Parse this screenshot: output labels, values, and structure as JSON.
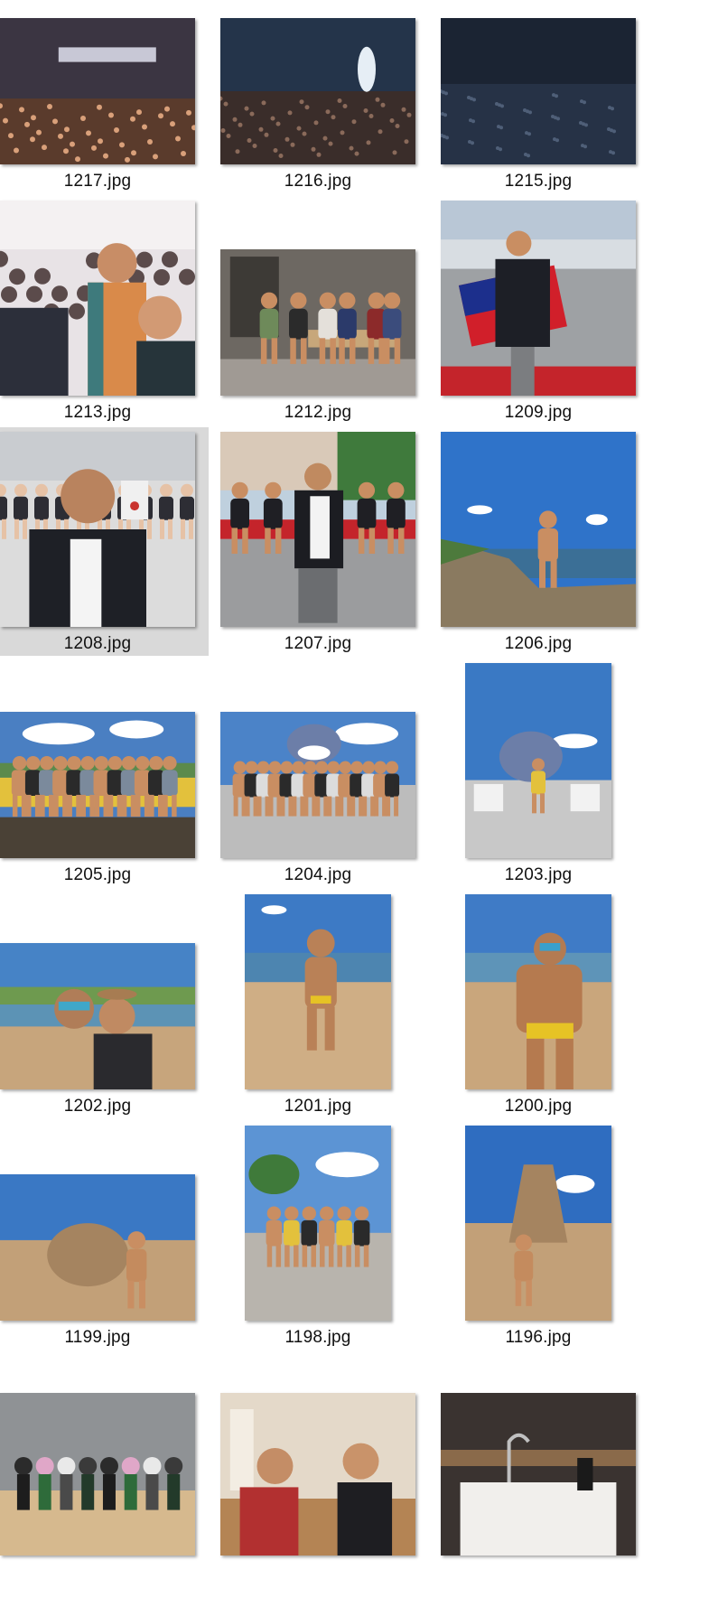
{
  "files": [
    {
      "name": "1217.jpg",
      "scene": "concert-crowd",
      "orientation": "landscape"
    },
    {
      "name": "1216.jpg",
      "scene": "concert-stage",
      "orientation": "landscape"
    },
    {
      "name": "1215.jpg",
      "scene": "concert-dark",
      "orientation": "landscape"
    },
    {
      "name": "1213.jpg",
      "scene": "stadium-selfie",
      "orientation": "square"
    },
    {
      "name": "1212.jpg",
      "scene": "indoor-group",
      "orientation": "landscape"
    },
    {
      "name": "1209.jpg",
      "scene": "flag-plaza",
      "orientation": "square"
    },
    {
      "name": "1208.jpg",
      "scene": "event-selfie",
      "orientation": "square",
      "selected": true
    },
    {
      "name": "1207.jpg",
      "scene": "street-portrait",
      "orientation": "square"
    },
    {
      "name": "1206.jpg",
      "scene": "coast-rocks",
      "orientation": "square"
    },
    {
      "name": "1205.jpg",
      "scene": "deck-group",
      "orientation": "landscape"
    },
    {
      "name": "1204.jpg",
      "scene": "stitch-group",
      "orientation": "landscape"
    },
    {
      "name": "1203.jpg",
      "scene": "stitch-solo",
      "orientation": "portrait"
    },
    {
      "name": "1202.jpg",
      "scene": "beach-selfie",
      "orientation": "landscape"
    },
    {
      "name": "1201.jpg",
      "scene": "beach-standing",
      "orientation": "portrait"
    },
    {
      "name": "1200.jpg",
      "scene": "beach-closeup",
      "orientation": "portrait"
    },
    {
      "name": "1199.jpg",
      "scene": "sand-sculpture-wide",
      "orientation": "landscape"
    },
    {
      "name": "1198.jpg",
      "scene": "walk-group",
      "orientation": "portrait"
    },
    {
      "name": "1196.jpg",
      "scene": "sand-sculpture-tall",
      "orientation": "portrait"
    },
    {
      "name": "",
      "scene": "figurines",
      "orientation": "landscape-partial"
    },
    {
      "name": "",
      "scene": "cafe-selfie",
      "orientation": "landscape-partial"
    },
    {
      "name": "",
      "scene": "bathroom-sink",
      "orientation": "landscape-partial"
    }
  ],
  "colors": {
    "selection": "#d9d9d9",
    "caption": "#111111"
  }
}
